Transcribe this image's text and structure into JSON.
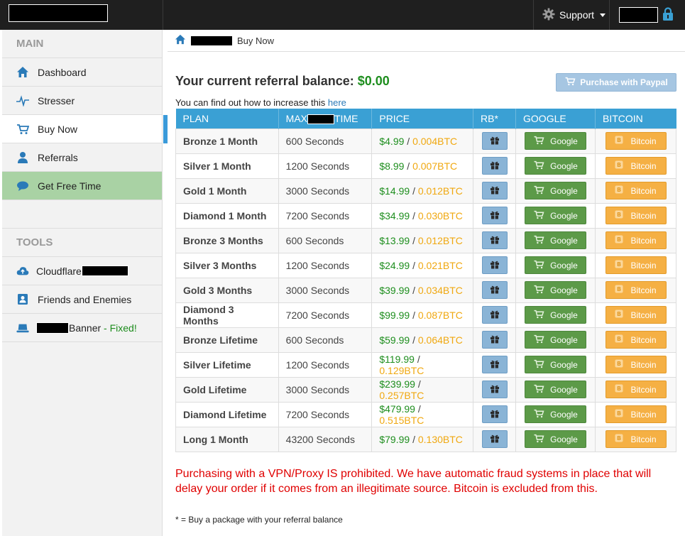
{
  "topbar": {
    "support_label": "Support",
    "icons": {
      "support": "gear-icon",
      "user": "lock-icon"
    }
  },
  "sidebar": {
    "main_header": "MAIN",
    "items": [
      {
        "label": "Dashboard",
        "icon": "home-icon"
      },
      {
        "label": "Stresser",
        "icon": "pulse-icon"
      },
      {
        "label": "Buy Now",
        "icon": "cart-icon"
      },
      {
        "label": "Referrals",
        "icon": "user-icon"
      },
      {
        "label": "Get Free Time",
        "icon": "chat-bubble-icon"
      }
    ],
    "tools_header": "TOOLS",
    "tools": [
      {
        "label": "Cloudflare",
        "icon": "cloud-upload-icon"
      },
      {
        "label": "Friends and Enemies",
        "icon": "contact-card-icon"
      },
      {
        "label": "Banner",
        "suffix": " - Fixed!",
        "icon": "laptop-icon"
      }
    ]
  },
  "breadcrumb": {
    "current": "Buy Now"
  },
  "balance": {
    "label": "Your current referral balance: ",
    "amount": "$0.00"
  },
  "paypal_button": "Purchase with Paypal",
  "hint": {
    "text": "You can find out how to increase this ",
    "link": "here"
  },
  "table": {
    "headers": {
      "plan": "PLAN",
      "max_prefix": "MAX",
      "max_suffix": "TIME",
      "price": "PRICE",
      "rb": "RB*",
      "google": "GOOGLE",
      "bitcoin": "BITCOIN"
    },
    "google_label": "Google",
    "bitcoin_label": "Bitcoin",
    "rows": [
      {
        "plan": "Bronze 1 Month",
        "time": "600 Seconds",
        "usd": "$4.99",
        "btc": "0.004BTC"
      },
      {
        "plan": "Silver 1 Month",
        "time": "1200 Seconds",
        "usd": "$8.99",
        "btc": "0.007BTC"
      },
      {
        "plan": "Gold 1 Month",
        "time": "3000 Seconds",
        "usd": "$14.99",
        "btc": "0.012BTC"
      },
      {
        "plan": "Diamond 1 Month",
        "time": "7200 Seconds",
        "usd": "$34.99",
        "btc": "0.030BTC"
      },
      {
        "plan": "Bronze 3 Months",
        "time": "600 Seconds",
        "usd": "$13.99",
        "btc": "0.012BTC"
      },
      {
        "plan": "Silver 3 Months",
        "time": "1200 Seconds",
        "usd": "$24.99",
        "btc": "0.021BTC"
      },
      {
        "plan": "Gold 3 Months",
        "time": "3000 Seconds",
        "usd": "$39.99",
        "btc": "0.034BTC"
      },
      {
        "plan": "Diamond 3 Months",
        "time": "7200 Seconds",
        "usd": "$99.99",
        "btc": "0.087BTC"
      },
      {
        "plan": "Bronze Lifetime",
        "time": "600 Seconds",
        "usd": "$59.99",
        "btc": "0.064BTC"
      },
      {
        "plan": "Silver Lifetime",
        "time": "1200 Seconds",
        "usd": "$119.99",
        "btc": "0.129BTC"
      },
      {
        "plan": "Gold Lifetime",
        "time": "3000 Seconds",
        "usd": "$239.99",
        "btc": "0.257BTC"
      },
      {
        "plan": "Diamond Lifetime",
        "time": "7200 Seconds",
        "usd": "$479.99",
        "btc": "0.515BTC"
      },
      {
        "plan": "Long 1 Month",
        "time": "43200 Seconds",
        "usd": "$79.99",
        "btc": "0.130BTC"
      }
    ]
  },
  "warning": "Purchasing with a VPN/Proxy IS prohibited. We have automatic fraud systems in place that will delay your order if it comes from an illegitimate source. Bitcoin is excluded from this.",
  "footnote": "* = Buy a package with your referral balance",
  "colors": {
    "header_blue": "#3aa0d4",
    "green": "#1e8e1e",
    "btc_orange": "#f0a810",
    "warning_red": "#e00000"
  }
}
